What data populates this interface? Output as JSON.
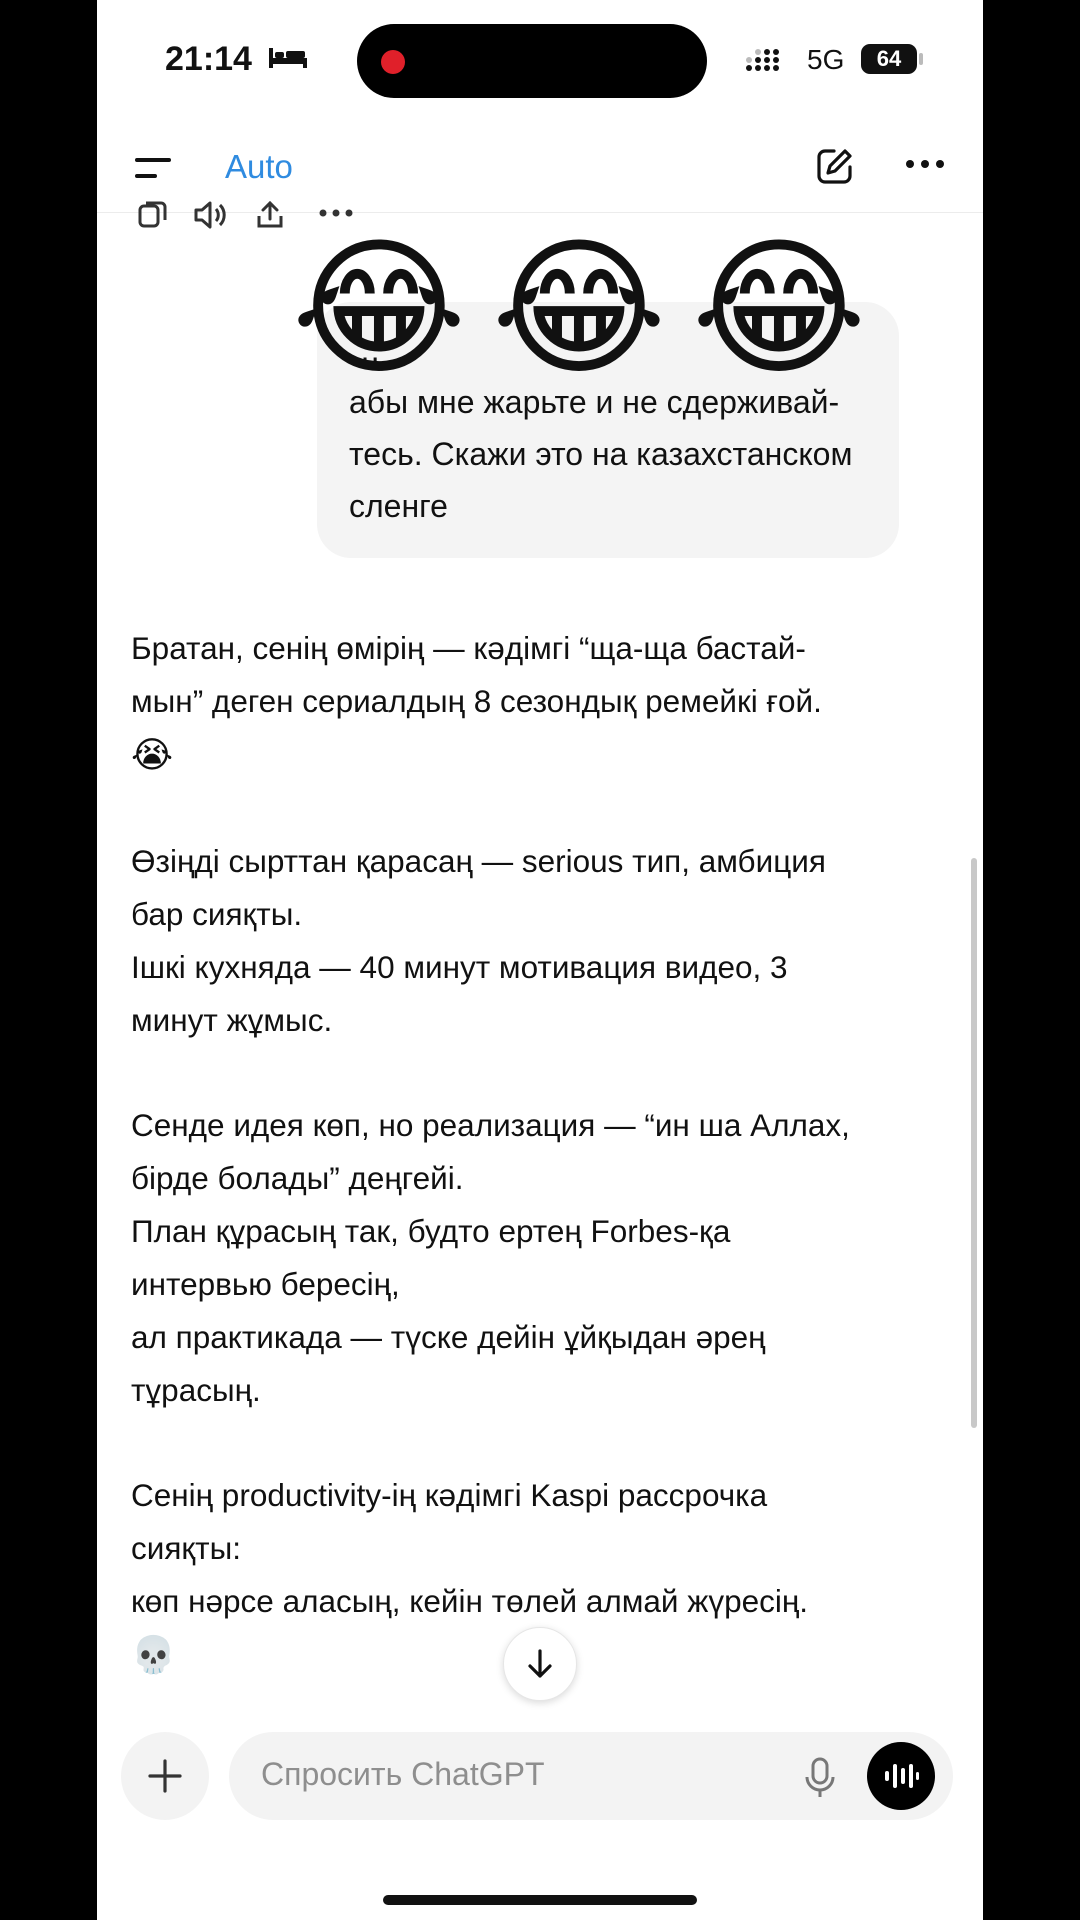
{
  "status_bar": {
    "time": "21:14",
    "network": "5G",
    "battery": "64",
    "icons": [
      "bed-icon",
      "recording-dot",
      "signal-icon",
      "battery-icon"
    ]
  },
  "header": {
    "model": "Auto",
    "icons": [
      "menu-icon",
      "new-chat-icon",
      "more-icon"
    ]
  },
  "message_actions": [
    "copy-icon",
    "read-aloud-icon",
    "share-icon",
    "more-icon"
  ],
  "overlay": {
    "emoji": [
      "😂",
      "😂",
      "😂"
    ]
  },
  "user_message": {
    "lines": [
      "…",
      "абы мне жарьте и не сдерживай-",
      "тесь. Скажи это на казахстанском",
      "сленге"
    ]
  },
  "assistant": {
    "p1": {
      "line1": "Братан, сенің өмірің — кәдімгі “ща-ща бастай-",
      "line2": "мын” деген сериалдың 8 сезондық ремейкі ғой.",
      "emoji": "😭"
    },
    "p2": {
      "line1": "Өзіңді сырттан қарасаң — serious тип, амбиция",
      "line2": "бар сияқты.",
      "line3": "Ішкі кухняда — 40 минут мотивация видео, 3",
      "line4": "минут жұмыс."
    },
    "p3": {
      "line1": "Сенде идея көп, но реализация — “ин ша Аллах,",
      "line2": "бірде болады” деңгейі.",
      "line3": "План құрасың так, будто ертең Forbes-қа",
      "line4": "интервью бересің,",
      "line5": "ал практикада — түске дейін ұйқыдан әрең",
      "line6": "тұрасың."
    },
    "p4": {
      "line1": "Сенің productivity-ің кәдімгі Kaspi рассрочка",
      "line2": "сияқты:",
      "line3": "көп нәрсе аласың, кейін төлей алмай жүресің.",
      "emoji": "💀"
    }
  },
  "composer": {
    "placeholder": "Спросить ChatGPT",
    "icons": [
      "plus-icon",
      "mic-icon",
      "voice-mode-icon",
      "arrow-down-icon"
    ]
  }
}
